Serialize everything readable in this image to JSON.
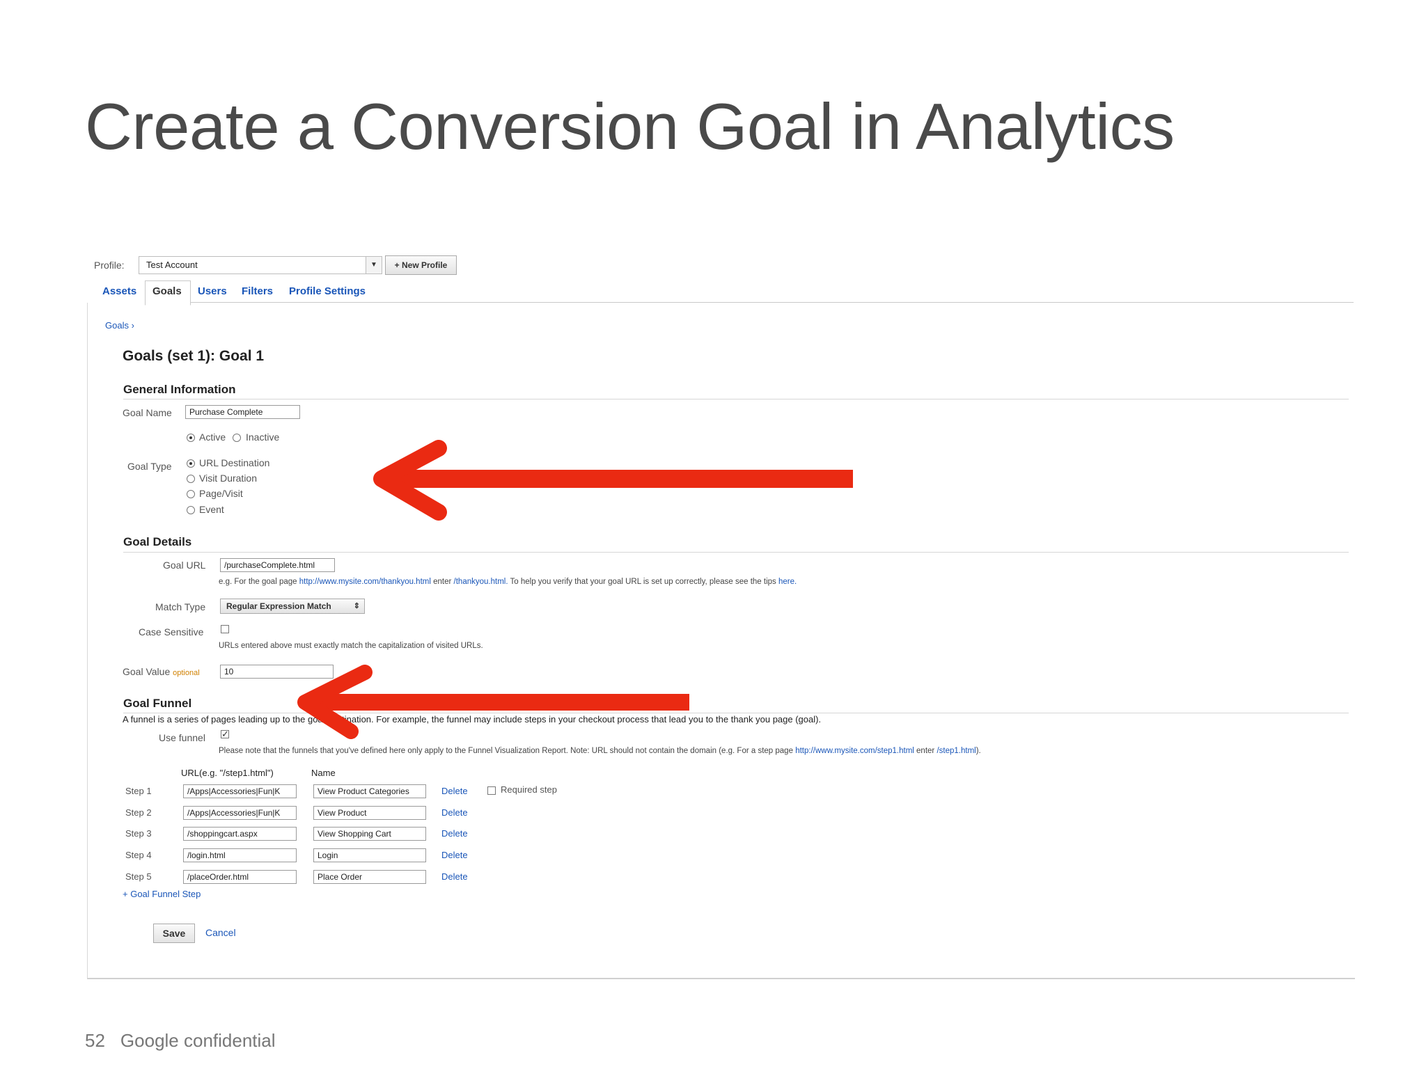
{
  "slide": {
    "title": "Create a Conversion Goal in Analytics",
    "page_number": "52",
    "footer_text": "Google confidential",
    "arrow_color": "#ea2a12"
  },
  "profile": {
    "label": "Profile:",
    "selected": "Test Account",
    "new_profile_button": "+ New Profile"
  },
  "tabs": [
    {
      "label": "Assets",
      "active": false
    },
    {
      "label": "Goals",
      "active": true
    },
    {
      "label": "Users",
      "active": false
    },
    {
      "label": "Filters",
      "active": false
    },
    {
      "label": "Profile Settings",
      "active": false
    }
  ],
  "breadcrumb": "Goals ›",
  "heading": "Goals (set 1): Goal 1",
  "general": {
    "title": "General Information",
    "goal_name_label": "Goal Name",
    "goal_name_value": "Purchase Complete",
    "status_active": "Active",
    "status_inactive": "Inactive",
    "goal_type_label": "Goal Type",
    "goal_types": [
      "URL Destination",
      "Visit Duration",
      "Page/Visit",
      "Event"
    ]
  },
  "details": {
    "title": "Goal Details",
    "goal_url_label": "Goal URL",
    "goal_url_value": "/purchaseComplete.html",
    "hint_prefix": "e.g. For the goal page",
    "hint_url": "http://www.mysite.com/thankyou.html",
    "hint_enter": "enter",
    "hint_path": "/thankyou.html.",
    "hint_rest": "To help you verify that your goal URL is set up correctly, please see the tips",
    "hint_here": "here.",
    "match_type_label": "Match Type",
    "match_type_value": "Regular Expression Match",
    "case_sensitive_label": "Case Sensitive",
    "case_hint": "URLs entered above must exactly match the capitalization of visited URLs.",
    "goal_value_label": "Goal Value",
    "goal_value_optional": "optional",
    "goal_value": "10"
  },
  "funnel": {
    "title": "Goal Funnel",
    "description": "A funnel is a series of pages leading up to the goal destination. For example, the funnel may include steps in your checkout process that lead you to the thank you page (goal).",
    "use_funnel_label": "Use funnel",
    "note_prefix": "Please note that the funnels that you've defined here only apply to the Funnel Visualization Report. Note: URL should not contain the domain (e.g. For a step page",
    "note_url": "http://www.mysite.com/step1.html",
    "note_enter": "enter",
    "note_path": "/step1.html",
    "note_end": ").",
    "col_url": "URL(e.g. \"/step1.html\")",
    "col_name": "Name",
    "delete_label": "Delete",
    "required_step_label": "Required step",
    "steps": [
      {
        "label": "Step 1",
        "url": "/Apps|Accessories|Fun|K",
        "name": "View Product Categories"
      },
      {
        "label": "Step 2",
        "url": "/Apps|Accessories|Fun|K",
        "name": "View Product"
      },
      {
        "label": "Step 3",
        "url": "/shoppingcart.aspx",
        "name": "View Shopping Cart"
      },
      {
        "label": "Step 4",
        "url": "/login.html",
        "name": "Login"
      },
      {
        "label": "Step 5",
        "url": "/placeOrder.html",
        "name": "Place Order"
      }
    ],
    "add_step": "+ Goal Funnel Step"
  },
  "actions": {
    "save": "Save",
    "cancel": "Cancel"
  }
}
